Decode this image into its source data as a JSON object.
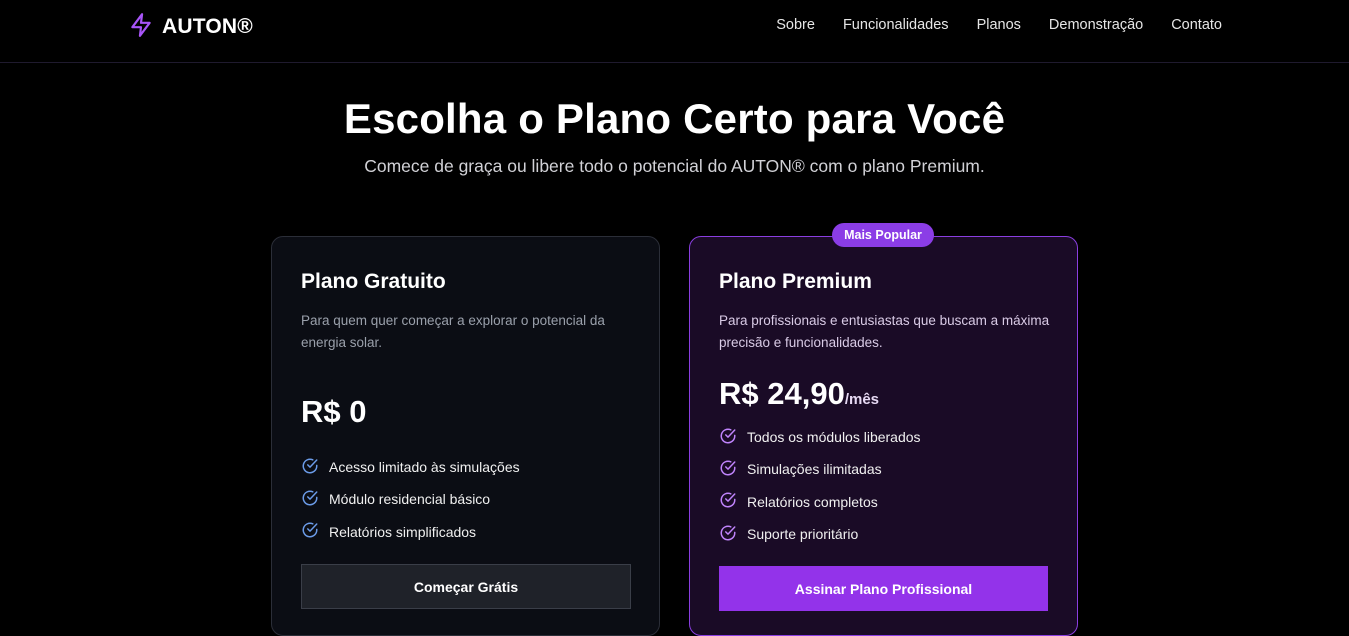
{
  "nav": {
    "brand": "AUTON®",
    "links": [
      "Sobre",
      "Funcionalidades",
      "Planos",
      "Demonstração",
      "Contato"
    ]
  },
  "hero": {
    "title": "Escolha o Plano Certo para Você",
    "subtitle": "Comece de graça ou libere todo o potencial do AUTON® com o plano Premium."
  },
  "plans": {
    "free": {
      "title": "Plano Gratuito",
      "description": "Para quem quer começar a explorar o potencial da energia solar.",
      "price": "R$ 0",
      "features": [
        "Acesso limitado às simulações",
        "Módulo residencial básico",
        "Relatórios simplificados"
      ],
      "cta": "Começar Grátis"
    },
    "premium": {
      "badge": "Mais Popular",
      "title": "Plano Premium",
      "description": "Para profissionais e entusiastas que buscam a máxima precisão e funcionalidades.",
      "price": "R$ 24,90",
      "period": "/mês",
      "features": [
        "Todos os módulos liberados",
        "Simulações ilimitadas",
        "Relatórios completos",
        "Suporte prioritário"
      ],
      "cta": "Assinar Plano Profissional"
    }
  },
  "colors": {
    "accent": "#9333ea",
    "free_check": "#6b9be8",
    "premium_check": "#c084fc"
  },
  "icons": {
    "logo": "lightning-bolt-icon",
    "feature": "check-circle-icon"
  }
}
